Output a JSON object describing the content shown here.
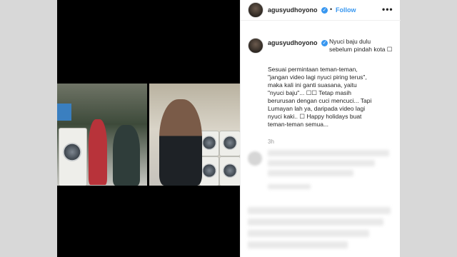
{
  "post": {
    "username": "agusyudhoyono",
    "follow_label": "Follow",
    "separator": "•",
    "more_label": "•••",
    "verified_mark": "✓",
    "caption_intro": "Nyuci baju dulu\nsebelum pindah kota ☐",
    "caption_body": "Sesuai permintaan teman-teman,\n\"jangan video lagi nyuci piring terus\",\nmaka kali ini ganti suasana, yaitu\n\"nyuci baju\"... ☐☐ Tetap masih\nberurusan dengan cuci mencuci... Tapi\nLumayan lah ya, daripada video lagi\nnyuci kaki.. ☐ Happy holidays buat\nteman-teman semua...",
    "timestamp": "3h"
  },
  "colors": {
    "accent": "#3897f0",
    "text": "#262626",
    "muted": "#999999"
  },
  "icons": {
    "verified": "verified-badge-icon",
    "more": "more-options-icon"
  }
}
